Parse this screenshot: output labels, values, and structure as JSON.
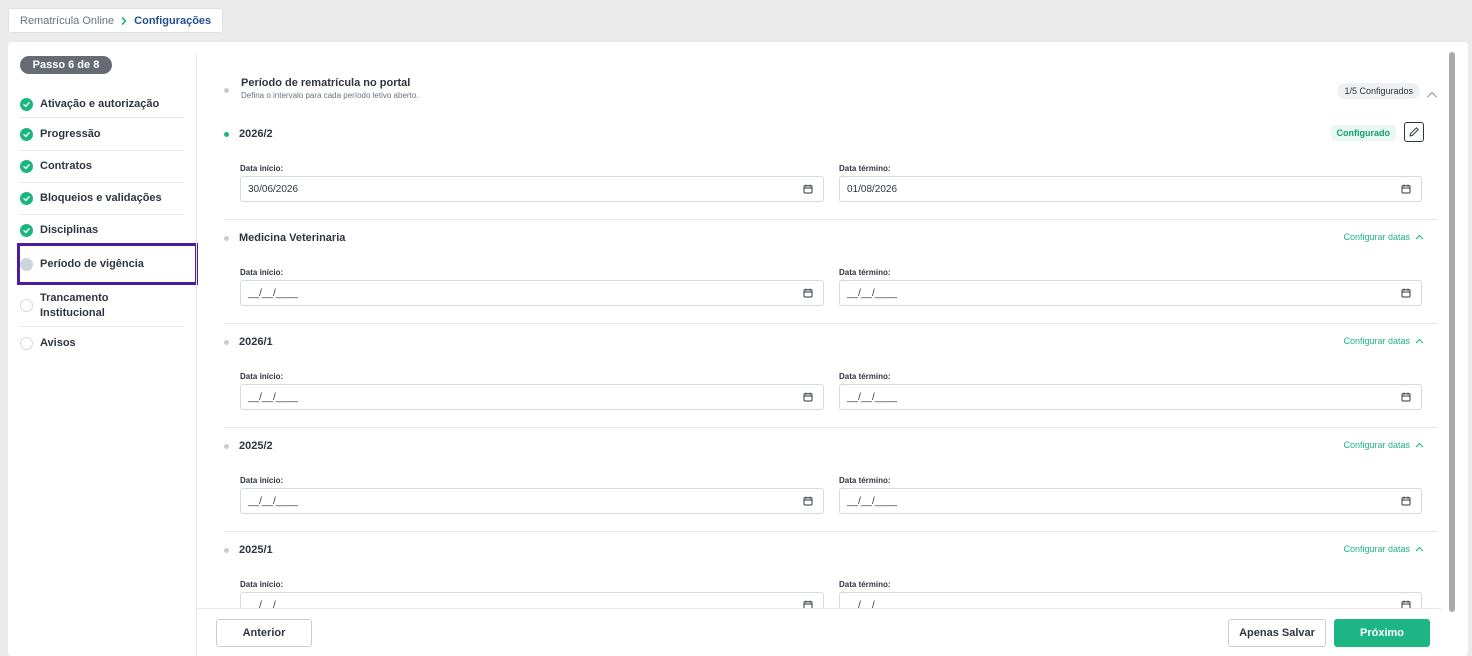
{
  "breadcrumb": {
    "root": "Rematrícula Online",
    "current": "Configurações"
  },
  "sidebar": {
    "step_badge": "Passo 6 de 8",
    "steps": [
      {
        "label": "Ativação e autorização",
        "status": "done"
      },
      {
        "label": "Progressão",
        "status": "done"
      },
      {
        "label": "Contratos",
        "status": "done"
      },
      {
        "label": "Bloqueios e validações",
        "status": "done"
      },
      {
        "label": "Disciplinas",
        "status": "done"
      },
      {
        "label": "Período de vigência",
        "status": "current"
      },
      {
        "label": "Trancamento Institucional",
        "status": "pending"
      },
      {
        "label": "Avisos",
        "status": "pending"
      }
    ]
  },
  "main": {
    "section_title": "Período de rematrícula no portal",
    "section_desc": "Defina o intervalo para cada período letivo aberto.",
    "count_badge": "1/5 Configurados",
    "start_label": "Data início:",
    "end_label": "Data término:",
    "empty_placeholder": "__/__/____",
    "configure_label": "Configurar datas",
    "configured_label": "Configurado",
    "periods": [
      {
        "name": "2026/2",
        "configured": true,
        "start": "30/06/2026",
        "end": "01/08/2026"
      },
      {
        "name": "Medicina Veterinaria",
        "configured": false,
        "start": "__/__/____",
        "end": "__/__/____"
      },
      {
        "name": "2026/1",
        "configured": false,
        "start": "__/__/____",
        "end": "__/__/____"
      },
      {
        "name": "2025/2",
        "configured": false,
        "start": "__/__/____",
        "end": "__/__/____"
      },
      {
        "name": "2025/1",
        "configured": false,
        "start": "__/__/____",
        "end": "__/__/____"
      }
    ]
  },
  "footer": {
    "prev": "Anterior",
    "save": "Apenas Salvar",
    "next": "Próximo"
  },
  "colors": {
    "accent": "#1db584",
    "highlight_border": "#4b1c9e",
    "text": "#2f3540"
  },
  "icons": [
    "chevron-right-icon",
    "check-icon",
    "chevron-up-icon",
    "edit-pencil-icon",
    "calendar-icon"
  ]
}
